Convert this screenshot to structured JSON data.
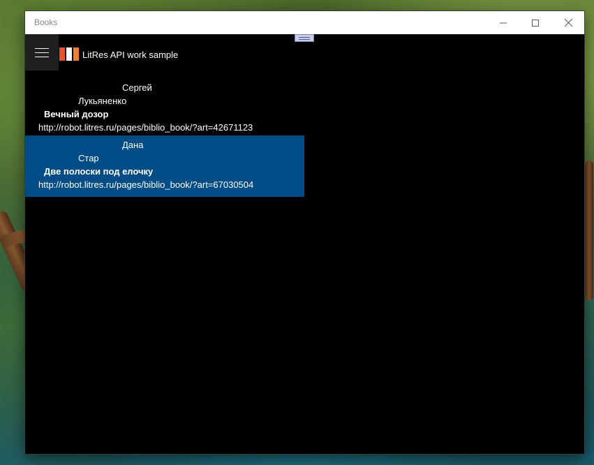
{
  "window": {
    "title": "Books",
    "controls": {
      "minimize_icon": "minimize-icon",
      "maximize_icon": "maximize-icon",
      "close_icon": "close-icon"
    }
  },
  "app": {
    "title": "LitRes API work sample",
    "menu_icon": "hamburger-menu-icon",
    "logo_colors": [
      "#e8542a",
      "#ffffff",
      "#f08030"
    ]
  },
  "books": [
    {
      "first_name": "Сергей",
      "last_name": "Лукьяненко",
      "title": "Вечный дозор",
      "url": "http://robot.litres.ru/pages/biblio_book/?art=42671123",
      "selected": false
    },
    {
      "first_name": "Дана",
      "last_name": "Стар",
      "title": "Две полоски под елочку",
      "url": "http://robot.litres.ru/pages/biblio_book/?art=67030504",
      "selected": true
    }
  ],
  "colors": {
    "selection": "#004c87",
    "background": "#000000",
    "titlebar": "#ffffff"
  }
}
